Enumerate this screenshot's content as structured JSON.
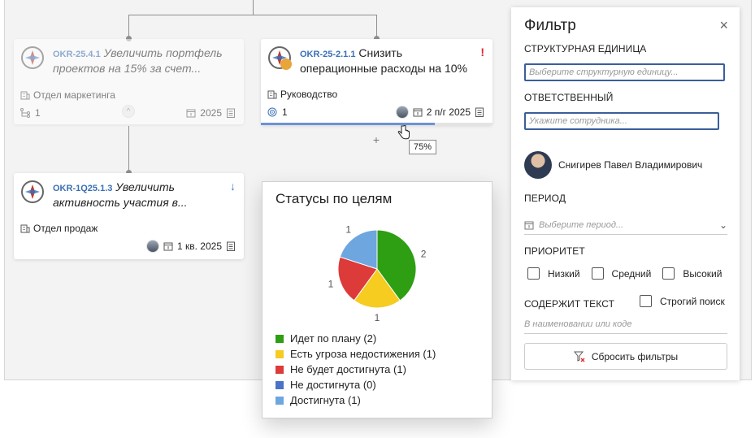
{
  "cards": [
    {
      "code": "OKR-25.4.1",
      "title": "Увеличить портфель проектов на 15% за счет...",
      "unit": "Отдел маркетинга",
      "children_count": "1",
      "period": "2025"
    },
    {
      "code": "OKR-25-2.1.1",
      "title": "Снизить операционные расходы на 10%",
      "unit": "Руководство",
      "children_count": "1",
      "period": "2 п/г 2025",
      "progress": 0.75
    },
    {
      "code": "OKR-1Q25.1.3",
      "title": "Увеличить активность участия в...",
      "unit": "Отдел продаж",
      "period": "1 кв. 2025"
    }
  ],
  "flags": {
    "priority_high": "!",
    "priority_low": "↓"
  },
  "tooltip": {
    "progress": "75%"
  },
  "plus": "+",
  "collapse": "^",
  "chart_data": {
    "type": "pie",
    "title": "Статусы по целям",
    "categories": [
      "Идет по плану",
      "Есть угроза недостижения",
      "Не будет достигнута",
      "Не достигнута",
      "Достигнута"
    ],
    "values": [
      2,
      1,
      1,
      0,
      1
    ],
    "legend": [
      "Идет по плану (2)",
      "Есть угроза недостижения (1)",
      "Не будет достигнута (1)",
      "Не достигнута (0)",
      "Достигнута (1)"
    ],
    "colors": [
      "#2e9e12",
      "#f5cc1f",
      "#dd3a3a",
      "#4a72c8",
      "#6ea6e0"
    ],
    "legend_placement": "bottom"
  },
  "filter": {
    "title": "Фильтр",
    "close": "×",
    "unit_label": "СТРУКТУРНАЯ ЕДИНИЦА",
    "unit_placeholder": "Выберите структурную единицу...",
    "responsible_label": "ОТВЕТСТВЕННЫЙ",
    "responsible_placeholder": "Укажите сотрудника...",
    "person_name": "Снигирев Павел Владимирович",
    "period_label": "ПЕРИОД",
    "period_placeholder": "Выберите период...",
    "priority_label": "ПРИОРИТЕТ",
    "priority_options": [
      "Низкий",
      "Средний",
      "Высокий"
    ],
    "text_label": "СОДЕРЖИТ ТЕКСТ",
    "strict_label": "Строгий поиск",
    "text_placeholder": "В наименовании или коде",
    "reset_label": "Сбросить фильтры"
  }
}
